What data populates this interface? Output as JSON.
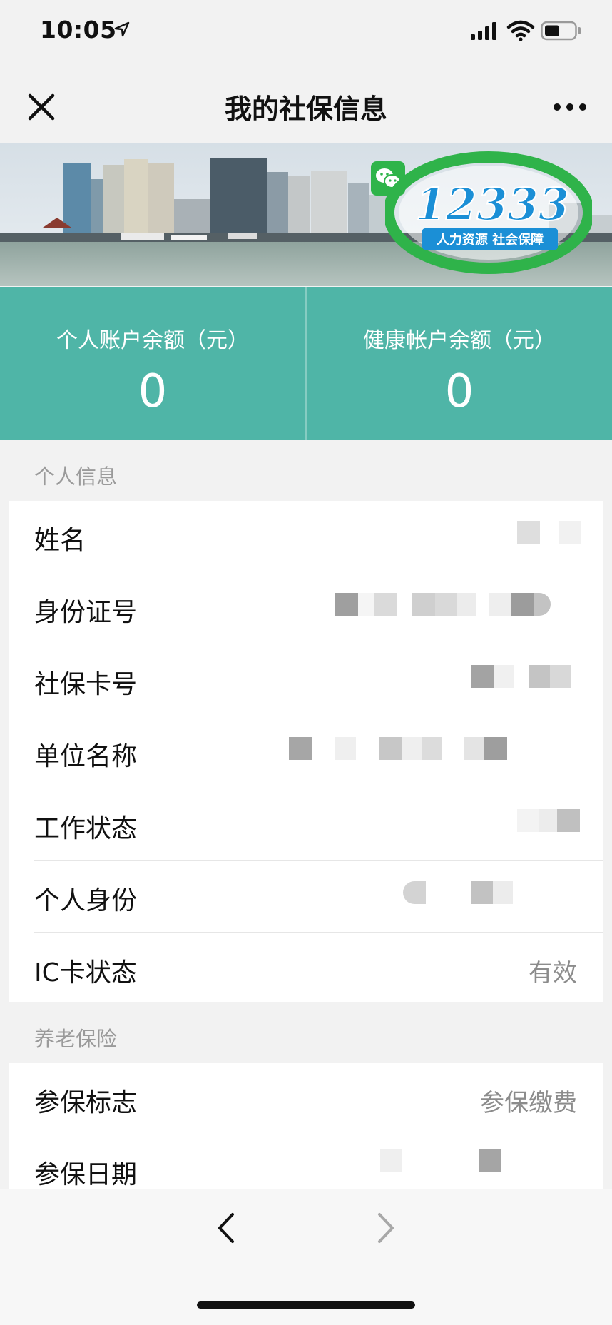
{
  "status_bar": {
    "time": "10:05"
  },
  "nav": {
    "title": "我的社保信息"
  },
  "banner": {
    "logo_number": "12333",
    "logo_tagline": "人力资源  社会保障"
  },
  "balances": [
    {
      "label": "个人账户余额（元）",
      "value": "0"
    },
    {
      "label": "健康帐户余额（元）",
      "value": "0"
    }
  ],
  "personal_info": {
    "header": "个人信息",
    "rows": [
      {
        "label": "姓名",
        "value": ""
      },
      {
        "label": "身份证号",
        "value": ""
      },
      {
        "label": "社保卡号",
        "value": ""
      },
      {
        "label": "单位名称",
        "value": ""
      },
      {
        "label": "工作状态",
        "value": ""
      },
      {
        "label": "个人身份",
        "value": ""
      },
      {
        "label": "IC卡状态",
        "value": "有效"
      }
    ]
  },
  "pension": {
    "header": "养老保险",
    "rows": [
      {
        "label": "参保标志",
        "value": "参保缴费"
      },
      {
        "label": "参保日期",
        "value": ""
      }
    ]
  },
  "colors": {
    "accent": "#4fb5a7",
    "background": "#f2f2f2"
  }
}
